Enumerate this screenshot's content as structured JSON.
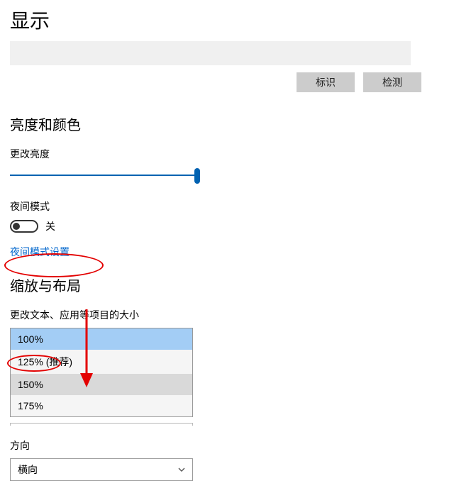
{
  "title": "显示",
  "buttons": {
    "identify": "标识",
    "detect": "检测"
  },
  "brightness_section": "亮度和颜色",
  "brightness_label": "更改亮度",
  "night_mode_label": "夜间模式",
  "toggle_state": "关",
  "night_mode_settings_link": "夜间模式设置",
  "scale_section": "缩放与布局",
  "scale_label": "更改文本、应用等项目的大小",
  "scale_options": {
    "opt0": "100%",
    "opt1": "125% (推荐)",
    "opt2": "150%",
    "opt3": "175%"
  },
  "orientation_label": "方向",
  "orientation_value": "横向"
}
